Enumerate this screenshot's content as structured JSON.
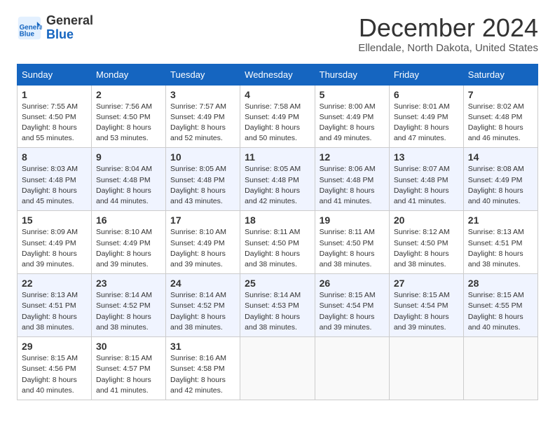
{
  "header": {
    "logo_line1": "General",
    "logo_line2": "Blue",
    "month": "December 2024",
    "location": "Ellendale, North Dakota, United States"
  },
  "columns": [
    "Sunday",
    "Monday",
    "Tuesday",
    "Wednesday",
    "Thursday",
    "Friday",
    "Saturday"
  ],
  "weeks": [
    [
      {
        "day": "1",
        "info": "Sunrise: 7:55 AM\nSunset: 4:50 PM\nDaylight: 8 hours and 55 minutes."
      },
      {
        "day": "2",
        "info": "Sunrise: 7:56 AM\nSunset: 4:50 PM\nDaylight: 8 hours and 53 minutes."
      },
      {
        "day": "3",
        "info": "Sunrise: 7:57 AM\nSunset: 4:49 PM\nDaylight: 8 hours and 52 minutes."
      },
      {
        "day": "4",
        "info": "Sunrise: 7:58 AM\nSunset: 4:49 PM\nDaylight: 8 hours and 50 minutes."
      },
      {
        "day": "5",
        "info": "Sunrise: 8:00 AM\nSunset: 4:49 PM\nDaylight: 8 hours and 49 minutes."
      },
      {
        "day": "6",
        "info": "Sunrise: 8:01 AM\nSunset: 4:49 PM\nDaylight: 8 hours and 47 minutes."
      },
      {
        "day": "7",
        "info": "Sunrise: 8:02 AM\nSunset: 4:48 PM\nDaylight: 8 hours and 46 minutes."
      }
    ],
    [
      {
        "day": "8",
        "info": "Sunrise: 8:03 AM\nSunset: 4:48 PM\nDaylight: 8 hours and 45 minutes."
      },
      {
        "day": "9",
        "info": "Sunrise: 8:04 AM\nSunset: 4:48 PM\nDaylight: 8 hours and 44 minutes."
      },
      {
        "day": "10",
        "info": "Sunrise: 8:05 AM\nSunset: 4:48 PM\nDaylight: 8 hours and 43 minutes."
      },
      {
        "day": "11",
        "info": "Sunrise: 8:05 AM\nSunset: 4:48 PM\nDaylight: 8 hours and 42 minutes."
      },
      {
        "day": "12",
        "info": "Sunrise: 8:06 AM\nSunset: 4:48 PM\nDaylight: 8 hours and 41 minutes."
      },
      {
        "day": "13",
        "info": "Sunrise: 8:07 AM\nSunset: 4:48 PM\nDaylight: 8 hours and 41 minutes."
      },
      {
        "day": "14",
        "info": "Sunrise: 8:08 AM\nSunset: 4:49 PM\nDaylight: 8 hours and 40 minutes."
      }
    ],
    [
      {
        "day": "15",
        "info": "Sunrise: 8:09 AM\nSunset: 4:49 PM\nDaylight: 8 hours and 39 minutes."
      },
      {
        "day": "16",
        "info": "Sunrise: 8:10 AM\nSunset: 4:49 PM\nDaylight: 8 hours and 39 minutes."
      },
      {
        "day": "17",
        "info": "Sunrise: 8:10 AM\nSunset: 4:49 PM\nDaylight: 8 hours and 39 minutes."
      },
      {
        "day": "18",
        "info": "Sunrise: 8:11 AM\nSunset: 4:50 PM\nDaylight: 8 hours and 38 minutes."
      },
      {
        "day": "19",
        "info": "Sunrise: 8:11 AM\nSunset: 4:50 PM\nDaylight: 8 hours and 38 minutes."
      },
      {
        "day": "20",
        "info": "Sunrise: 8:12 AM\nSunset: 4:50 PM\nDaylight: 8 hours and 38 minutes."
      },
      {
        "day": "21",
        "info": "Sunrise: 8:13 AM\nSunset: 4:51 PM\nDaylight: 8 hours and 38 minutes."
      }
    ],
    [
      {
        "day": "22",
        "info": "Sunrise: 8:13 AM\nSunset: 4:51 PM\nDaylight: 8 hours and 38 minutes."
      },
      {
        "day": "23",
        "info": "Sunrise: 8:14 AM\nSunset: 4:52 PM\nDaylight: 8 hours and 38 minutes."
      },
      {
        "day": "24",
        "info": "Sunrise: 8:14 AM\nSunset: 4:52 PM\nDaylight: 8 hours and 38 minutes."
      },
      {
        "day": "25",
        "info": "Sunrise: 8:14 AM\nSunset: 4:53 PM\nDaylight: 8 hours and 38 minutes."
      },
      {
        "day": "26",
        "info": "Sunrise: 8:15 AM\nSunset: 4:54 PM\nDaylight: 8 hours and 39 minutes."
      },
      {
        "day": "27",
        "info": "Sunrise: 8:15 AM\nSunset: 4:54 PM\nDaylight: 8 hours and 39 minutes."
      },
      {
        "day": "28",
        "info": "Sunrise: 8:15 AM\nSunset: 4:55 PM\nDaylight: 8 hours and 40 minutes."
      }
    ],
    [
      {
        "day": "29",
        "info": "Sunrise: 8:15 AM\nSunset: 4:56 PM\nDaylight: 8 hours and 40 minutes."
      },
      {
        "day": "30",
        "info": "Sunrise: 8:15 AM\nSunset: 4:57 PM\nDaylight: 8 hours and 41 minutes."
      },
      {
        "day": "31",
        "info": "Sunrise: 8:16 AM\nSunset: 4:58 PM\nDaylight: 8 hours and 42 minutes."
      },
      null,
      null,
      null,
      null
    ]
  ]
}
